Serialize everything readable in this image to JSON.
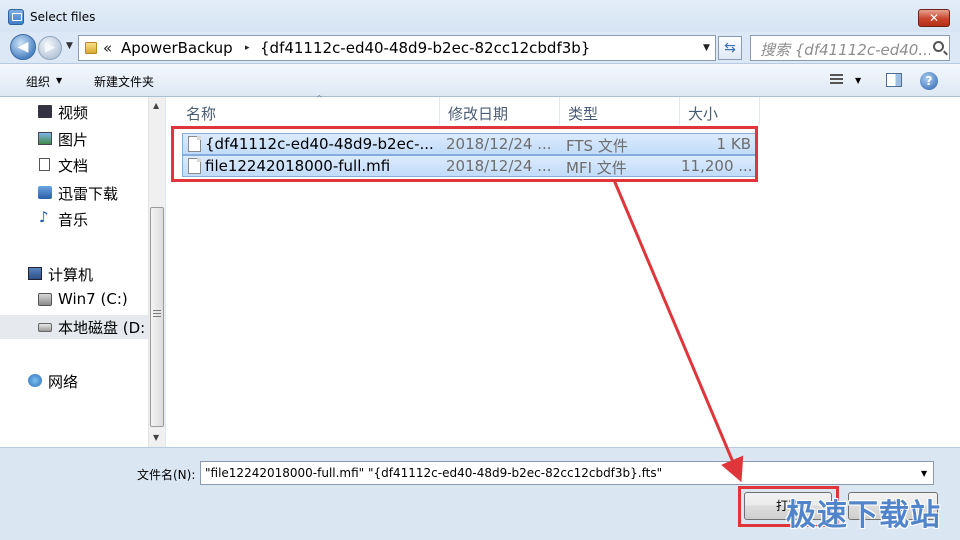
{
  "window": {
    "title": "Select files",
    "close_label": "✕"
  },
  "nav": {
    "back_glyph": "◀",
    "forward_glyph": "▶",
    "dropdown_glyph": "▼"
  },
  "address": {
    "chevron": "«",
    "crumbs": [
      "ApowerBackup",
      "{df41112c-ed40-48d9-b2ec-82cc12cbdf3b}"
    ],
    "separator": "▸",
    "dropdown_glyph": "▼"
  },
  "refresh_glyph": "⇆",
  "search": {
    "placeholder": "搜索 {df41112c-ed40..."
  },
  "toolbar": {
    "organize_label": "组织",
    "arrow": "▼",
    "new_folder_label": "新建文件夹",
    "help_label": "?"
  },
  "sidebar": {
    "items": [
      {
        "label": "视频",
        "icon": "video-icon"
      },
      {
        "label": "图片",
        "icon": "image-icon"
      },
      {
        "label": "文档",
        "icon": "document-icon"
      },
      {
        "label": "迅雷下载",
        "icon": "download-icon"
      },
      {
        "label": "音乐",
        "icon": "music-icon"
      },
      {
        "label": "计算机",
        "icon": "computer-icon"
      },
      {
        "label": "Win7 (C:)",
        "icon": "drive-c-icon"
      },
      {
        "label": "本地磁盘 (D:",
        "icon": "drive-d-icon",
        "selected": true
      },
      {
        "label": "网络",
        "icon": "network-icon"
      }
    ],
    "scroll_up": "▲",
    "scroll_down": "▼"
  },
  "columns": {
    "name": "名称",
    "date": "修改日期",
    "type": "类型",
    "size": "大小",
    "sort_glyph": "^"
  },
  "files": [
    {
      "name": "{df41112c-ed40-48d9-b2ec-...",
      "date": "2018/12/24 ...",
      "type": "FTS 文件",
      "size": "1 KB"
    },
    {
      "name": "file12242018000-full.mfi",
      "date": "2018/12/24 ...",
      "type": "MFI 文件",
      "size": "11,200 ..."
    }
  ],
  "footer": {
    "filename_label": "文件名(N):",
    "filename_value": "\"file12242018000-full.mfi\" \"{df41112c-ed40-48d9-b2ec-82cc12cbdf3b}.fts\"",
    "dropdown_glyph": "▼",
    "open_label": "打开",
    "cancel_label": "取消"
  },
  "watermark": "极速下载站",
  "annotation_color": "#e0353a"
}
